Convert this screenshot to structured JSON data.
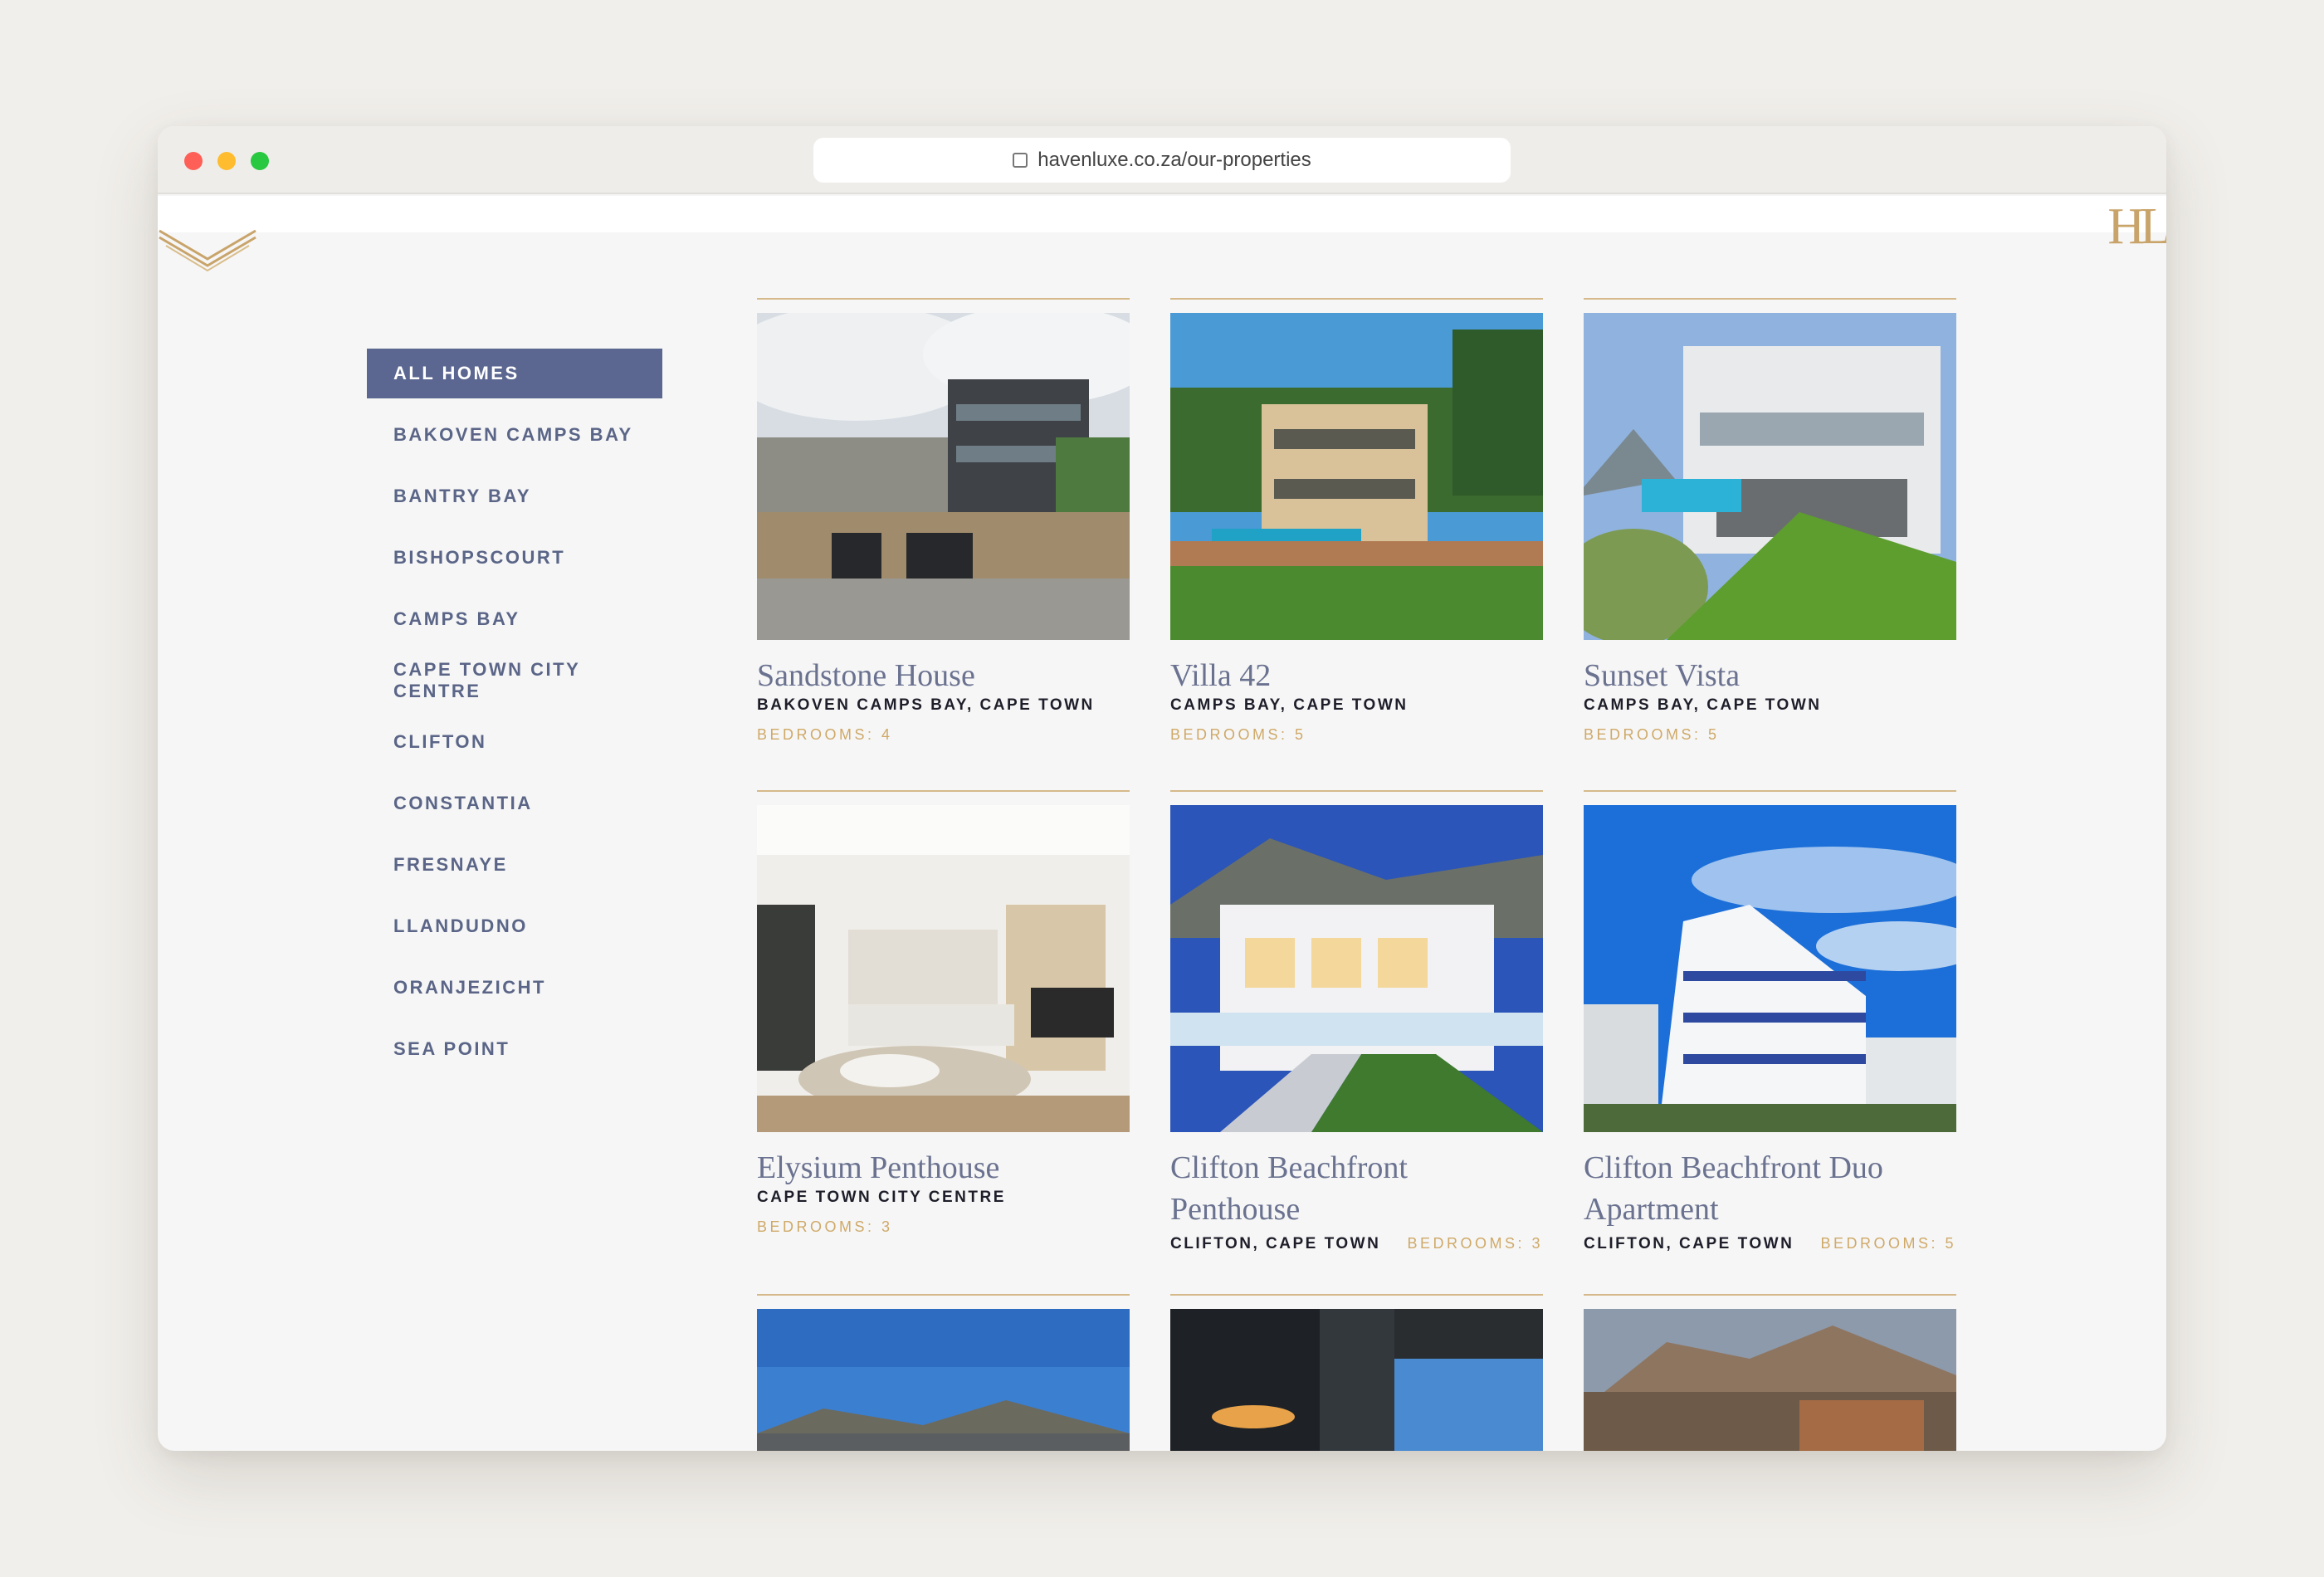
{
  "browser": {
    "url": "havenluxe.co.za/our-properties"
  },
  "brand": {
    "monogram": "HL"
  },
  "sidebar": {
    "items": [
      {
        "label": "ALL HOMES",
        "active": true
      },
      {
        "label": "BAKOVEN CAMPS BAY"
      },
      {
        "label": "BANTRY BAY"
      },
      {
        "label": "BISHOPSCOURT"
      },
      {
        "label": "CAMPS BAY"
      },
      {
        "label": "CAPE TOWN CITY CENTRE"
      },
      {
        "label": "CLIFTON"
      },
      {
        "label": "CONSTANTIA"
      },
      {
        "label": "FRESNAYE"
      },
      {
        "label": "LLANDUDNO"
      },
      {
        "label": "ORANJEZICHT"
      },
      {
        "label": "SEA POINT"
      }
    ]
  },
  "properties": [
    {
      "title": "Sandstone House",
      "location": "BAKOVEN CAMPS BAY, CAPE TOWN",
      "bedrooms": "BEDROOMS: 4"
    },
    {
      "title": "Villa 42",
      "location": "CAMPS BAY, CAPE TOWN",
      "bedrooms": "BEDROOMS: 5"
    },
    {
      "title": "Sunset Vista",
      "location": "CAMPS BAY, CAPE TOWN",
      "bedrooms": "BEDROOMS: 5"
    },
    {
      "title": "Elysium Penthouse",
      "location": "CAPE TOWN CITY CENTRE",
      "bedrooms": "BEDROOMS: 3"
    },
    {
      "title": "Clifton Beachfront Penthouse",
      "location": "CLIFTON, CAPE TOWN",
      "bedrooms": "BEDROOMS: 3"
    },
    {
      "title": "Clifton Beachfront Duo Apartment",
      "location": "CLIFTON, CAPE TOWN",
      "bedrooms": "BEDROOMS: 5"
    }
  ],
  "colors": {
    "accent": "#5b6790",
    "gold": "#cfa968",
    "heading": "#6a7290"
  }
}
